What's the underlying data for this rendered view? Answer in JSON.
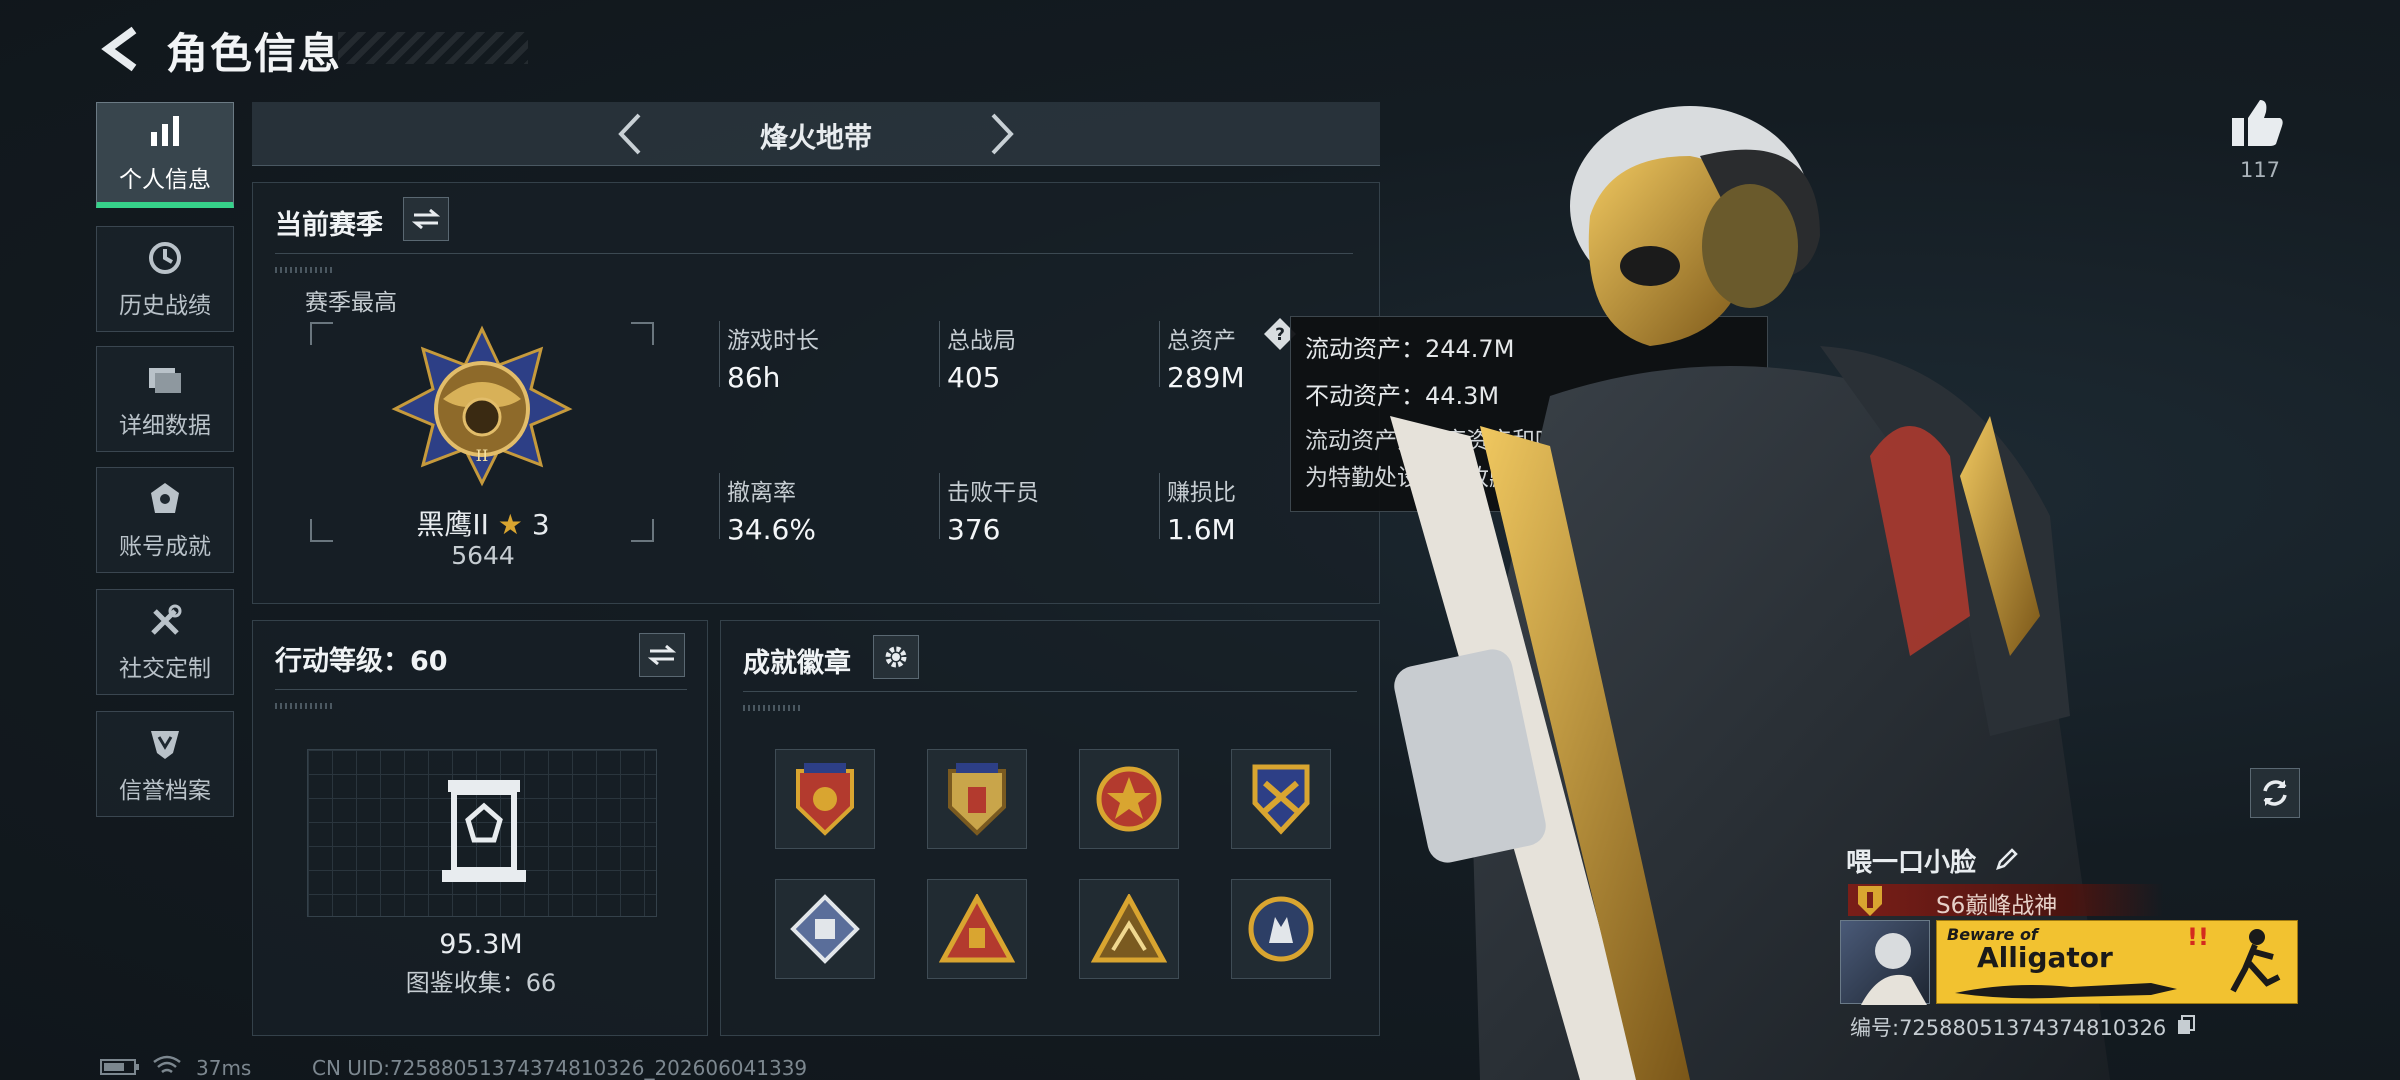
{
  "header": {
    "title": "角色信息"
  },
  "sidebar": {
    "items": [
      {
        "label": "个人信息",
        "icon": "bar-chart-icon",
        "active": true
      },
      {
        "label": "历史战绩",
        "icon": "clock-icon"
      },
      {
        "label": "详细数据",
        "icon": "folder-icon"
      },
      {
        "label": "账号成就",
        "icon": "achievement-icon"
      },
      {
        "label": "社交定制",
        "icon": "wrench-icon"
      },
      {
        "label": "信誉档案",
        "icon": "shield-icon"
      }
    ]
  },
  "mode": {
    "title": "烽火地带"
  },
  "season": {
    "title": "当前赛季",
    "best_label": "赛季最高",
    "rank_name": "黑鹰II",
    "rank_stars": "3",
    "rank_points": "5644",
    "stats": [
      {
        "label": "游戏时长",
        "value": "86h"
      },
      {
        "label": "总战局",
        "value": "405"
      },
      {
        "label": "总资产",
        "value": "289M"
      },
      {
        "label": "撤离率",
        "value": "34.6%"
      },
      {
        "label": "击败干员",
        "value": "376"
      },
      {
        "label": "赚损比",
        "value": "1.6M"
      }
    ]
  },
  "tooltip": {
    "liquid": "流动资产：244.7M",
    "fixed": "不动资产：44.3M",
    "desc_line1": "流动资产为仓库资产和哈夫币，不动资产",
    "desc_line2": "为特勤处设施和收藏室设施"
  },
  "action_level": {
    "title": "行动等级：60",
    "value": "95.3M",
    "collection": "图鉴收集：66"
  },
  "achievements": {
    "title": "成就徽章",
    "badges": [
      "badge-1",
      "badge-2",
      "badge-3",
      "badge-4",
      "badge-5",
      "badge-6",
      "badge-7",
      "badge-8"
    ]
  },
  "profile": {
    "likes": "117",
    "player_name": "喂一口小脸",
    "title_tag": "S6巅峰战神",
    "banner_line1": "Beware of",
    "banner_line2": "Alligator",
    "player_id": "编号:725880513743748103​26"
  },
  "status_bar": {
    "ping": "37ms",
    "uid": "CN UID:725880513743748103​26_202606041339"
  },
  "colors": {
    "accent_green": "#36d28a",
    "gold": "#d9a530",
    "banner_yellow": "#f2c230"
  }
}
